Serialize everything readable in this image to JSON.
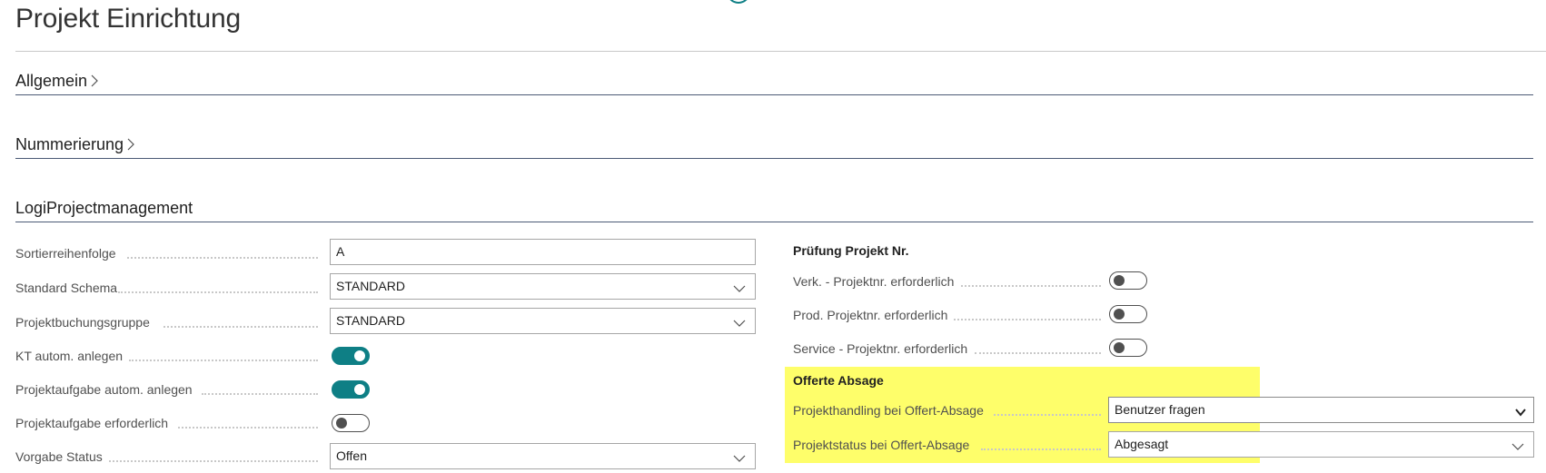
{
  "page": {
    "title": "Projekt Einrichtung"
  },
  "sections": {
    "allgemein": "Allgemein",
    "nummerierung": "Nummerierung",
    "logi": "LogiProjectmanagement"
  },
  "left_fields": {
    "sortierreihenfolge": {
      "label": "Sortierreihenfolge",
      "value": "A"
    },
    "standard_schema": {
      "label": "Standard Schema",
      "value": "STANDARD"
    },
    "projektbuchungsgruppe": {
      "label": "Projektbuchungsgruppe",
      "value": "STANDARD"
    },
    "kt_autom": {
      "label": "KT autom. anlegen",
      "checked": true
    },
    "projektaufgabe_autom": {
      "label": "Projektaufgabe autom. anlegen",
      "checked": true
    },
    "projektaufgabe_erforderlich": {
      "label": "Projektaufgabe erforderlich",
      "checked": false
    },
    "vorgabe_status": {
      "label": "Vorgabe Status",
      "value": "Offen"
    }
  },
  "right_groups": {
    "pruefung": {
      "title": "Prüfung Projekt Nr.",
      "verk": {
        "label": "Verk. - Projektnr. erforderlich",
        "checked": false
      },
      "prod": {
        "label": "Prod. Projektnr. erforderlich",
        "checked": false
      },
      "service": {
        "label": "Service - Projektnr. erforderlich",
        "checked": false
      }
    },
    "offerte": {
      "title": "Offerte Absage",
      "handling": {
        "label": "Projekthandling bei Offert-Absage",
        "value": "Benutzer fragen"
      },
      "status": {
        "label": "Projektstatus bei Offert-Absage",
        "value": "Abgesagt"
      }
    }
  },
  "colors": {
    "accent": "#0e7f85",
    "highlight": "#fefe6a",
    "section_line": "#4b5a75"
  },
  "icons": [
    "chevron-right-icon",
    "chevron-down-icon"
  ]
}
